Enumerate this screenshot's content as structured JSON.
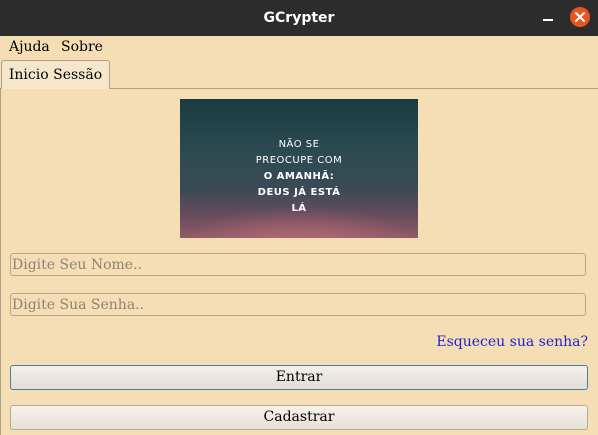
{
  "window": {
    "title": "GCrypter"
  },
  "menu": {
    "items": [
      {
        "label": "Ajuda"
      },
      {
        "label": "Sobre"
      }
    ]
  },
  "tabs": [
    {
      "label": "Inicio Sessão"
    }
  ],
  "banner": {
    "lines": [
      "NÃO SE",
      "PREOCUPE COM",
      "O AMANHÃ:",
      "DEUS JÁ ESTÁ",
      "LÁ"
    ]
  },
  "form": {
    "name_placeholder": "Digite Seu Nome..",
    "password_placeholder": "Digite Sua Senha..",
    "forgot_link": "Esqueceu sua senha?",
    "login_button": "Entrar",
    "signup_button": "Cadastrar"
  },
  "colors": {
    "background": "#f5deb3",
    "titlebar": "#2c2c2c",
    "close_button": "#e95420",
    "link": "#1f1fd8"
  }
}
